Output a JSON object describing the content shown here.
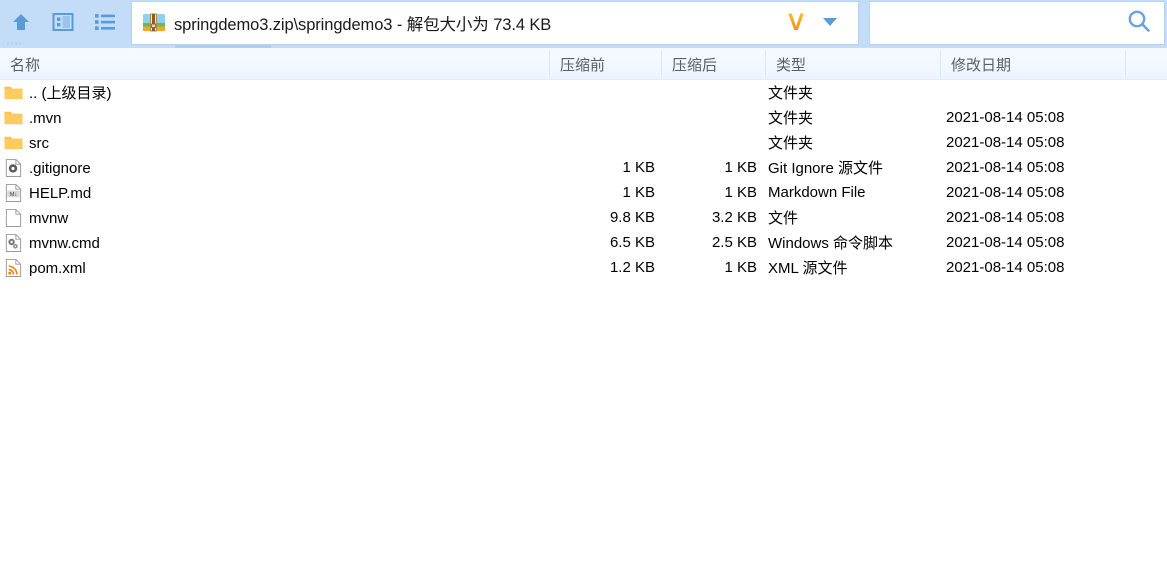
{
  "window": {
    "title": "springdemo3.zip\\springdemo3 - 解包大小为 73.4 KB"
  },
  "toolbar": {
    "up_label": "上一级",
    "preview_label": "预览",
    "list_label": "列表",
    "icons": [
      "up-arrow-icon",
      "preview-panel-icon",
      "list-view-icon"
    ]
  },
  "brand": {
    "logo_text": "V",
    "logo_color": "#f59a14",
    "caret": "chevron-down-icon"
  },
  "search": {
    "placeholder": "",
    "value": "",
    "icon": "search-icon"
  },
  "columns": [
    {
      "key": "name",
      "label": "名称"
    },
    {
      "key": "pre",
      "label": "压缩前"
    },
    {
      "key": "post",
      "label": "压缩后"
    },
    {
      "key": "type",
      "label": "类型"
    },
    {
      "key": "date",
      "label": "修改日期"
    }
  ],
  "rows": [
    {
      "name": ".. (上级目录)",
      "icon": "folder-icon",
      "pre": "",
      "post": "",
      "type": "文件夹",
      "date": ""
    },
    {
      "name": ".mvn",
      "icon": "folder-icon",
      "pre": "",
      "post": "",
      "type": "文件夹",
      "date": "2021-08-14 05:08"
    },
    {
      "name": "src",
      "icon": "folder-icon",
      "pre": "",
      "post": "",
      "type": "文件夹",
      "date": "2021-08-14 05:08"
    },
    {
      "name": ".gitignore",
      "icon": "gear-file-icon",
      "pre": "1 KB",
      "post": "1 KB",
      "type": "Git Ignore 源文件",
      "date": "2021-08-14 05:08"
    },
    {
      "name": "HELP.md",
      "icon": "markdown-file-icon",
      "pre": "1 KB",
      "post": "1 KB",
      "type": "Markdown File",
      "date": "2021-08-14 05:08"
    },
    {
      "name": "mvnw",
      "icon": "blank-file-icon",
      "pre": "9.8 KB",
      "post": "3.2 KB",
      "type": "文件",
      "date": "2021-08-14 05:08"
    },
    {
      "name": "mvnw.cmd",
      "icon": "script-file-icon",
      "pre": "6.5 KB",
      "post": "2.5 KB",
      "type": "Windows 命令脚本",
      "date": "2021-08-14 05:08"
    },
    {
      "name": "pom.xml",
      "icon": "xml-file-icon",
      "pre": "1.2 KB",
      "post": "1 KB",
      "type": "XML 源文件",
      "date": "2021-08-14 05:08"
    }
  ],
  "theme": {
    "toolbar_bg": "#c3dcf7",
    "header_bg": "#f4f9ff",
    "icon_blue": "#5b9bd5",
    "folder_yellow": "#fcc250"
  }
}
